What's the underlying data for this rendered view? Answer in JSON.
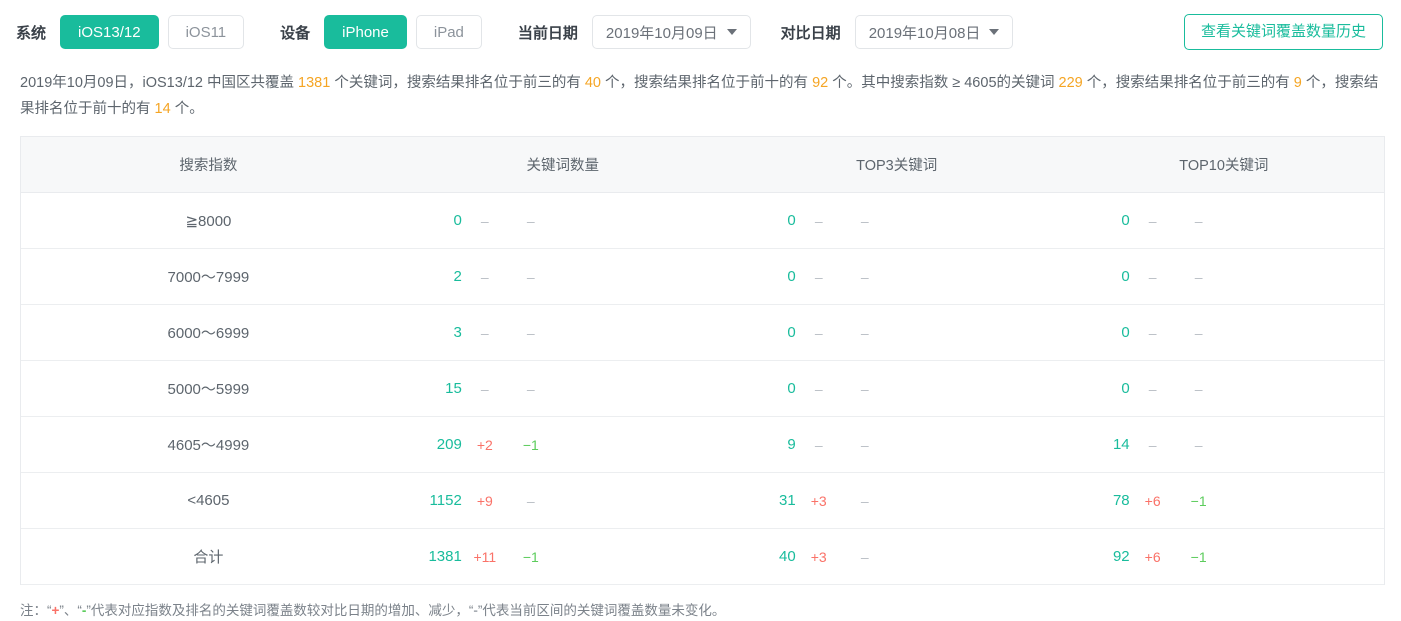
{
  "toolbar": {
    "system_label": "系统",
    "system_options": [
      {
        "label": "iOS13/12",
        "active": true
      },
      {
        "label": "iOS11",
        "active": false
      }
    ],
    "device_label": "设备",
    "device_options": [
      {
        "label": "iPhone",
        "active": true
      },
      {
        "label": "iPad",
        "active": false
      }
    ],
    "current_date_label": "当前日期",
    "current_date_value": "2019年10月09日",
    "compare_date_label": "对比日期",
    "compare_date_value": "2019年10月08日",
    "history_button": "查看关键词覆盖数量历史",
    "caret_icon": "chevron-down-icon",
    "accent_color": "#19bc9c"
  },
  "summary": {
    "p1": "2019年10月09日，iOS13/12 中国区共覆盖 ",
    "total_keywords": "1381",
    "p2": " 个关键词，搜索结果排名位于前三的有 ",
    "top3": "40",
    "p3": " 个，搜索结果排名位于前十的有 ",
    "top10": "92",
    "p4": " 个。其中搜索指数 ≥ 4605的关键词 ",
    "above_index": "229",
    "p5": " 个，搜索结果排名位于前三的有 ",
    "above_top3": "9",
    "p6": " 个，搜索结果排名位于前十的有 ",
    "above_top10": "14",
    "p7": " 个。",
    "highlight_color": "#f5a524"
  },
  "table": {
    "headers": {
      "index": "搜索指数",
      "count": "关键词数量",
      "top3": "TOP3关键词",
      "top10": "TOP10关键词"
    },
    "rows": [
      {
        "index": "≧8000",
        "count": {
          "value": "0",
          "up": "–",
          "down": "–"
        },
        "top3": {
          "value": "0",
          "up": "–",
          "down": "–"
        },
        "top10": {
          "value": "0",
          "up": "–",
          "down": "–"
        }
      },
      {
        "index": "7000～7999",
        "count": {
          "value": "2",
          "up": "–",
          "down": "–"
        },
        "top3": {
          "value": "0",
          "up": "–",
          "down": "–"
        },
        "top10": {
          "value": "0",
          "up": "–",
          "down": "–"
        }
      },
      {
        "index": "6000～6999",
        "count": {
          "value": "3",
          "up": "–",
          "down": "–"
        },
        "top3": {
          "value": "0",
          "up": "–",
          "down": "–"
        },
        "top10": {
          "value": "0",
          "up": "–",
          "down": "–"
        }
      },
      {
        "index": "5000～5999",
        "count": {
          "value": "15",
          "up": "–",
          "down": "–"
        },
        "top3": {
          "value": "0",
          "up": "–",
          "down": "–"
        },
        "top10": {
          "value": "0",
          "up": "–",
          "down": "–"
        }
      },
      {
        "index": "4605～4999",
        "count": {
          "value": "209",
          "up": "+2",
          "down": "−1"
        },
        "top3": {
          "value": "9",
          "up": "–",
          "down": "–"
        },
        "top10": {
          "value": "14",
          "up": "–",
          "down": "–"
        }
      },
      {
        "index": "<4605",
        "count": {
          "value": "1152",
          "up": "+9",
          "down": "–"
        },
        "top3": {
          "value": "31",
          "up": "+3",
          "down": "–"
        },
        "top10": {
          "value": "78",
          "up": "+6",
          "down": "−1"
        }
      },
      {
        "index": "合计",
        "count": {
          "value": "1381",
          "up": "+11",
          "down": "−1"
        },
        "top3": {
          "value": "40",
          "up": "+3",
          "down": "–"
        },
        "top10": {
          "value": "92",
          "up": "+6",
          "down": "−1"
        }
      }
    ],
    "value_color": "#19bc9c",
    "increase_color": "#fa7268",
    "decrease_color": "#5ccc5c",
    "dash_color": "#b9bec4"
  },
  "note": {
    "prefix": "注：“",
    "plus": "+",
    "mid1": "”、“",
    "minus": "-",
    "mid2": "”代表对应指数及排名的关键词覆盖数较对比日期的增加、减少，“",
    "neutral": "-",
    "suffix": "”代表当前区间的关键词覆盖数量未变化。"
  }
}
